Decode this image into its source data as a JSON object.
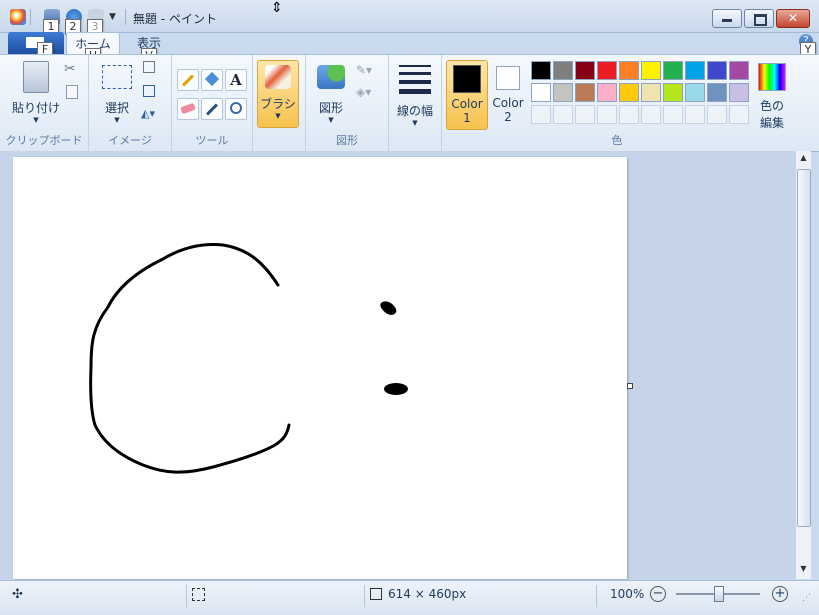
{
  "window": {
    "title": "無題 - ペイント"
  },
  "keytips": {
    "qa1": "1",
    "qa2": "2",
    "qa3": "3",
    "file": "F",
    "home": "H",
    "view": "V",
    "help": "Y"
  },
  "tabs": {
    "home": "ホーム",
    "view": "表示"
  },
  "ribbon": {
    "clipboard": {
      "paste_label": "貼り付け",
      "group_label": "クリップボード"
    },
    "image": {
      "select_label": "選択",
      "group_label": "イメージ"
    },
    "tools": {
      "group_label": "ツール"
    },
    "brush": {
      "label": "ブラシ"
    },
    "shapes": {
      "label": "図形",
      "group_label": "図形"
    },
    "size": {
      "label": "線の幅"
    },
    "colors": {
      "color1_label": "Color",
      "color1_num": "1",
      "color2_label": "Color",
      "color2_num": "2",
      "edit_label_1": "色の",
      "edit_label_2": "編集",
      "group_label": "色",
      "color1_value": "#000000",
      "color2_value": "#ffffff",
      "palette_row1": [
        "#000000",
        "#7f7f7f",
        "#880015",
        "#ed1c24",
        "#ff7f27",
        "#fff200",
        "#22b14c",
        "#00a2e8",
        "#3f48cc",
        "#a349a4"
      ],
      "palette_row2": [
        "#ffffff",
        "#c3c3c3",
        "#b97a57",
        "#ffaec9",
        "#ffc90e",
        "#efe4b0",
        "#b5e61d",
        "#99d9ea",
        "#7092be",
        "#c8bfe7"
      ]
    }
  },
  "status": {
    "image_size": "614 × 460px",
    "zoom": "100%"
  }
}
